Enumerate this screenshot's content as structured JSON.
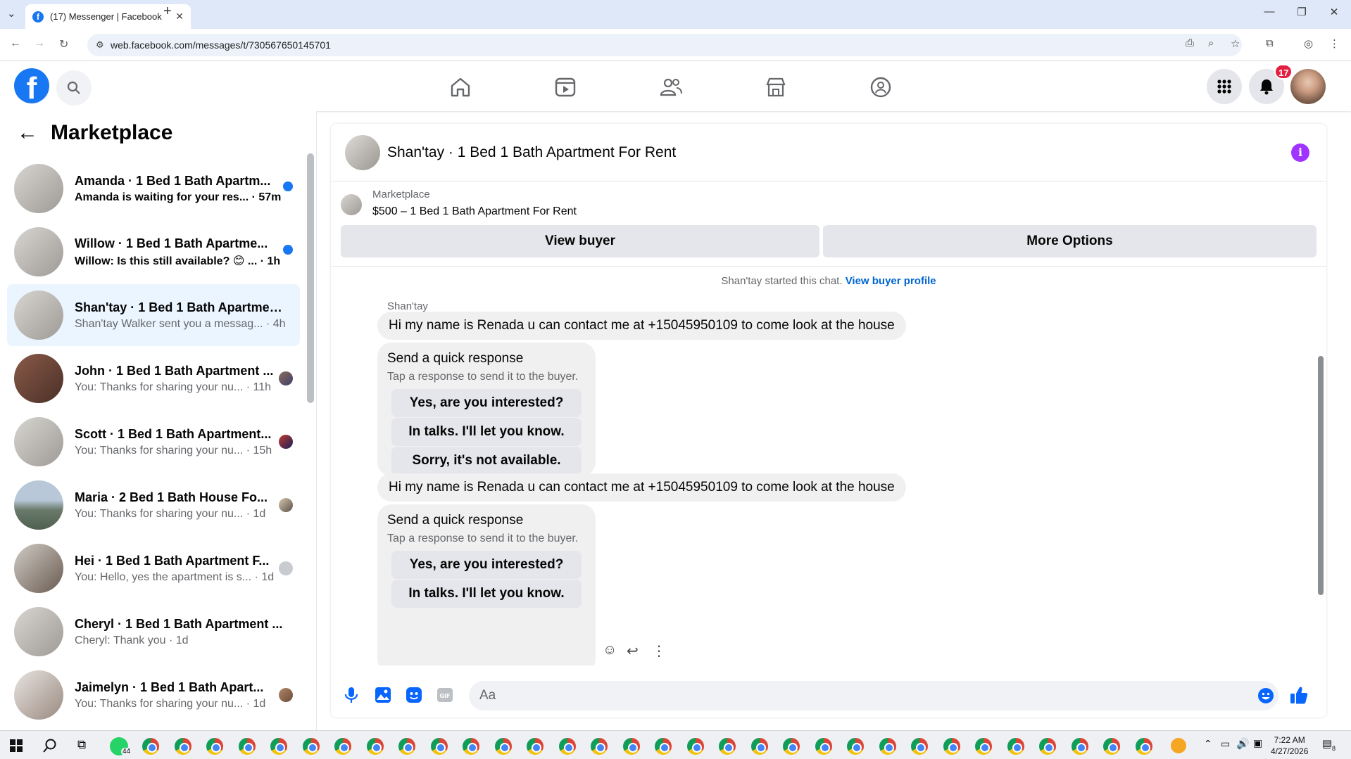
{
  "browser": {
    "tab_title": "(17) Messenger | Facebook",
    "url": "web.facebook.com/messages/t/730567650145701"
  },
  "header": {
    "notification_count": "17"
  },
  "sidebar": {
    "title": "Marketplace",
    "conversations": [
      {
        "name": "Amanda · 1 Bed 1 Bath Apartm...",
        "preview": "Amanda is waiting for your res... · 57m",
        "unread": true
      },
      {
        "name": "Willow · 1 Bed 1 Bath Apartme...",
        "preview": "Willow: Is this still available? 😊 ... · 1h",
        "unread": true
      },
      {
        "name": "Shan'tay · 1 Bed 1 Bath Apartmen...",
        "preview": "Shan'tay Walker sent you a messag... · 4h",
        "unread": false
      },
      {
        "name": "John · 1 Bed 1 Bath Apartment ...",
        "preview": "You: Thanks for sharing your nu... · 11h",
        "unread": false
      },
      {
        "name": "Scott · 1 Bed 1 Bath Apartment...",
        "preview": "You: Thanks for sharing your nu... · 15h",
        "unread": false
      },
      {
        "name": "Maria · 2 Bed 1 Bath House Fo...",
        "preview": "You: Thanks for sharing your nu... · 1d",
        "unread": false
      },
      {
        "name": "Hei · 1 Bed 1 Bath Apartment F...",
        "preview": "You: Hello, yes the apartment is s... · 1d",
        "unread": false
      },
      {
        "name": "Cheryl · 1 Bed 1 Bath Apartment ...",
        "preview": "Cheryl: Thank you · 1d",
        "unread": false
      },
      {
        "name": "Jaimelyn · 1 Bed 1 Bath Apart...",
        "preview": "You: Thanks for sharing your nu... · 1d",
        "unread": false
      }
    ]
  },
  "chat": {
    "title": "Shan'tay · 1 Bed 1 Bath Apartment For Rent",
    "listing_source": "Marketplace",
    "listing_title": "$500 – 1 Bed 1 Bath Apartment For Rent",
    "view_buyer": "View buyer",
    "more_options": "More Options",
    "system_text": "Shan'tay started this chat.",
    "system_link": "View buyer profile",
    "sender": "Shan'tay",
    "message_1": "Hi my name is Renada u can contact me at +15045950109 to come look at the house",
    "message_2": "Hi my name is Renada u can contact me at +15045950109 to come look at the house",
    "quick_response_title": "Send a quick response",
    "quick_response_subtitle": "Tap a response to send it to the buyer.",
    "quick_responses": [
      "Yes, are you interested?",
      "In talks. I'll let you know.",
      "Sorry, it's not available."
    ],
    "composer_placeholder": "Aa"
  },
  "taskbar": {
    "whatsapp_count": "44",
    "time": "7:22 AM",
    "date": "4/27/2026",
    "notification_count": "8"
  },
  "colors": {
    "brand": "#1877f2",
    "active_bg": "#ebf5ff",
    "info": "#a033ff",
    "badge": "#e41e3f"
  }
}
